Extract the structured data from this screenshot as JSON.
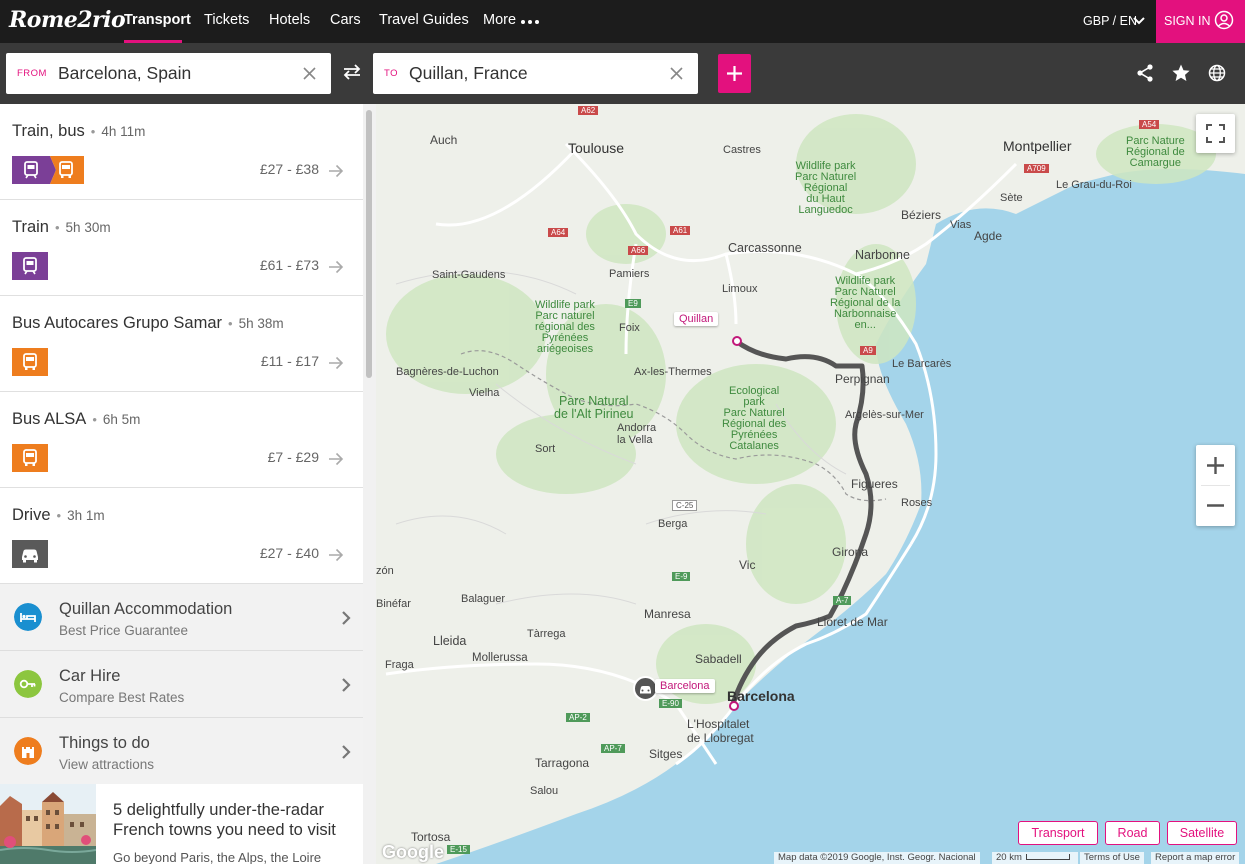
{
  "nav": {
    "logo": "Rome2rio",
    "items": [
      {
        "label": "Transport",
        "active": true
      },
      {
        "label": "Tickets"
      },
      {
        "label": "Hotels"
      },
      {
        "label": "Cars"
      },
      {
        "label": "Travel Guides"
      },
      {
        "label": "More"
      }
    ],
    "locale": "GBP / EN",
    "signin": "SIGN IN"
  },
  "search": {
    "from_label": "FROM",
    "from_value": "Barcelona, Spain",
    "to_label": "TO",
    "to_value": "Quillan, France"
  },
  "routes": [
    {
      "name": "Train, bus",
      "duration": "4h 11m",
      "price": "£27 - £38"
    },
    {
      "name": "Train",
      "duration": "5h 30m",
      "price": "£61 - £73"
    },
    {
      "name": "Bus Autocares Grupo Samar",
      "duration": "5h 38m",
      "price": "£11 - £17"
    },
    {
      "name": "Bus ALSA",
      "duration": "6h 5m",
      "price": "£7 - £29"
    },
    {
      "name": "Drive",
      "duration": "3h 1m",
      "price": "£27 - £40"
    }
  ],
  "extras": [
    {
      "title": "Quillan Accommodation",
      "subtitle": "Best Price Guarantee"
    },
    {
      "title": "Car Hire",
      "subtitle": "Compare Best Rates"
    },
    {
      "title": "Things to do",
      "subtitle": "View attractions"
    }
  ],
  "article": {
    "title": "5 delightfully under-the-radar French towns you need to visit",
    "subtitle": "Go beyond Paris, the Alps, the Loire"
  },
  "map": {
    "pins": {
      "origin": "Barcelona",
      "destination": "Quillan"
    },
    "labels": {
      "toulouse": "Toulouse",
      "montpellier": "Montpellier",
      "carcassonne": "Carcassonne",
      "narbonne": "Narbonne",
      "perpignan": "Perpignan",
      "beziers": "Béziers",
      "sete": "Sète",
      "auch": "Auch",
      "castres": "Castres",
      "agde": "Agde",
      "vias": "Vias",
      "graudu": "Le Grau-du-Roi",
      "pamiers": "Pamiers",
      "limoux": "Limoux",
      "foix": "Foix",
      "saintgaudens": "Saint-Gaudens",
      "axles": "Ax-les-Thermes",
      "bagneres": "Bagnères-de-Luchon",
      "vielha": "Vielha",
      "andorra": "Andorra\nla Vella",
      "sort": "Sort",
      "lebarcares": "Le Barcarès",
      "argeles": "Argelès-sur-Mer",
      "figueres": "Figueres",
      "roses": "Roses",
      "berga": "Berga",
      "girona": "Girona",
      "vic": "Vic",
      "balaguer": "Balaguer",
      "manresa": "Manresa",
      "lloret": "Lloret de Mar",
      "lleida": "Lleida",
      "tarrega": "Tàrrega",
      "mollerussa": "Mollerussa",
      "fraga": "Fraga",
      "sabadell": "Sabadell",
      "barcelona": "Barcelona",
      "hospitalet": "L'Hospitalet\nde Llobregat",
      "sitges": "Sitges",
      "tarragona": "Tarragona",
      "salou": "Salou",
      "tortosa": "Tortosa",
      "binefar": "Binéfar",
      "zon": "zón",
      "wp1": "Wildlife park\nParc Naturel\nRégional\ndu Haut\nLanguedoc",
      "wp2": "Wildlife park\nParc Naturel\nRégional de la\nNarbonnaise\nen...",
      "wp3": "Wildlife park\nParc naturel\nrégional des\nPyrénées\nariégeoises",
      "pn": "Parc Natural\nde l'Alt Pirineu",
      "eco": "Ecological\npark\nParc Naturel\nRégional des\nPyrénées\nCatalanes",
      "camargue": "Parc Nature\nRégional de\nCamargue"
    },
    "roads": [
      "A62",
      "A64",
      "A61",
      "A66",
      "E9",
      "A9",
      "A709",
      "A54",
      "C-25",
      "A-7",
      "E-9",
      "AP-2",
      "E-90",
      "AP-7",
      "E-15"
    ],
    "map_types": [
      "Transport",
      "Road",
      "Satellite"
    ],
    "attribution": "Map data ©2019 Google, Inst. Geogr. Nacional",
    "scale": "20 km",
    "terms": "Terms of Use",
    "report": "Report a map error",
    "google": "Google"
  },
  "colors": {
    "accent": "#e3117e",
    "train": "#7b3f97",
    "bus": "#ee7d1e",
    "car": "#5a5a5a",
    "sea": "#a4d4ea",
    "route": "#555555"
  }
}
